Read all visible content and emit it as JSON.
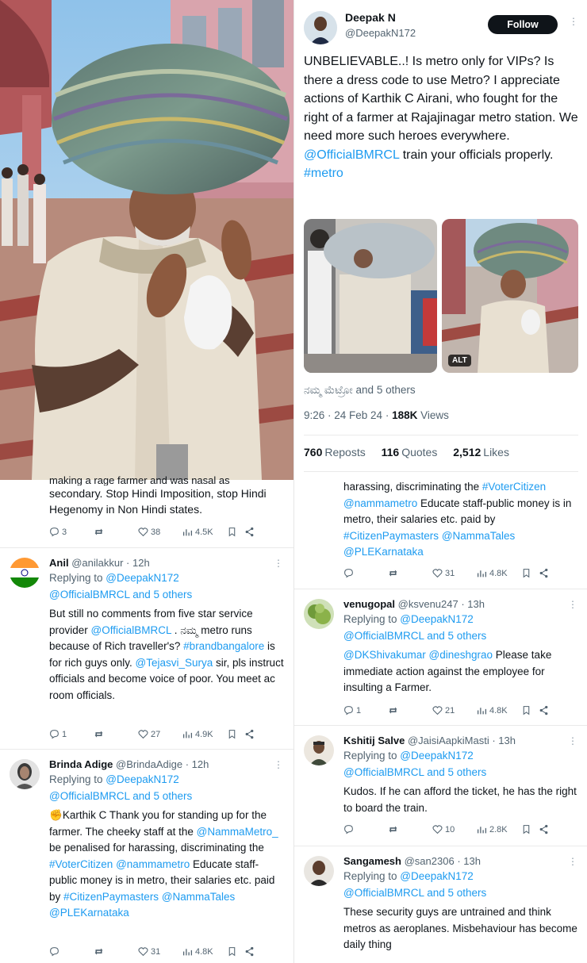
{
  "left_post_fragment": {
    "cut_line": "making a rage farmer and was nasal as",
    "text": "secondary. Stop Hindi Imposition, stop Hindi Hegenomy in Non Hindi states.",
    "replies": "3",
    "likes": "38",
    "views": "4.5K"
  },
  "left_replies": [
    {
      "name": "Anil",
      "handle": "@anilakkur",
      "time": "· 12h",
      "replying_to_prefix": "Replying to ",
      "replying_to": "@DeepakN172",
      "replying_others": "@OfficialBMRCL and 5 others",
      "text_a": "But still no comments from five star service provider ",
      "mention_a": "@OfficialBMRCL",
      "text_b": " . ನಮ್ಮ metro runs because of Rich traveller's? ",
      "hashtag_a": "#brandbangalore",
      "text_c": " is for rich guys only. ",
      "mention_b": "@Tejasvi_Surya",
      "text_d": " sir, pls instruct officials and become voice of poor. You meet ac room officials.",
      "replies": "1",
      "likes": "27",
      "views": "4.9K"
    },
    {
      "name": "Brinda Adige",
      "handle": "@BrindaAdige",
      "time": "· 12h",
      "replying_to_prefix": "Replying to ",
      "replying_to": "@DeepakN172",
      "replying_others": "@OfficialBMRCL and 5 others",
      "emoji": "✊",
      "text_a": "Karthik C Thank you for standing up for the farmer. The cheeky staff at the ",
      "mention_a": "@NammaMetro_",
      "text_b": " be penalised for harassing, discriminating the ",
      "hashtag_a": "#VoterCitizen",
      "mention_b": "@nammametro",
      "text_c": " Educate staff-public money is in metro, their salaries etc. paid by ",
      "hashtag_b": "#CitizenPaymasters",
      "mention_c": "@NammaTales",
      "mention_d": "@PLEKarnataka",
      "replies": "",
      "likes": "31",
      "views": "4.8K"
    }
  ],
  "main_tweet": {
    "name": "Deepak N",
    "handle": "@DeepakN172",
    "follow_label": "Follow",
    "text_a": "UNBELIEVABLE..! Is metro only for VIPs? Is there a dress code to use Metro? I appreciate actions of Karthik C Airani, who fought for the right of a farmer at Rajajinagar metro station. We need more such heroes everywhere. ",
    "mention": "@OfficialBMRCL",
    "text_b": " train your officials properly. ",
    "hashtag": "#metro",
    "alt_label": "ALT",
    "liked_by": "ನಮ್ಮ ಮೆಟ್ರೋ and 5 others",
    "time": "9:26 · 24 Feb 24 · ",
    "views_count": "188K",
    "views_label": " Views",
    "reposts_count": "760",
    "reposts_label": "Reposts",
    "quotes_count": "116",
    "quotes_label": "Quotes",
    "likes_count": "2,512",
    "likes_label": "Likes"
  },
  "right_fragment": {
    "text_a": "harassing, discriminating the ",
    "hashtag_a": "#VoterCitizen",
    "mention_a": "@nammametro",
    "text_b": " Educate staff-public money is in metro, their salaries etc. paid by ",
    "hashtag_b": "#CitizenPaymasters",
    "mention_b": "@NammaTales",
    "mention_c": "@PLEKarnataka",
    "likes": "31",
    "views": "4.8K"
  },
  "right_replies": [
    {
      "name": "venugopal",
      "handle": "@ksvenu247",
      "time": "· 13h",
      "replying_to_prefix": "Replying to ",
      "replying_to": "@DeepakN172",
      "replying_others": "@OfficialBMRCL and 5 others",
      "mention_a": "@DKShivakumar",
      "mention_b": "@dineshgrao",
      "text_a": " Please take immediate action against the employee for insulting a Farmer.",
      "replies": "1",
      "likes": "21",
      "views": "4.8K"
    },
    {
      "name": "Kshitij Salve",
      "handle": "@JaisiAapkiMasti",
      "time": "· 13h",
      "replying_to_prefix": "Replying to ",
      "replying_to": "@DeepakN172",
      "replying_others": "@OfficialBMRCL and 5 others",
      "text_a": "Kudos. If he can afford the ticket, he has the right to board the train.",
      "replies": "",
      "likes": "10",
      "views": "2.8K"
    },
    {
      "name": "Sangamesh",
      "handle": "@san2306",
      "time": "· 13h",
      "replying_to_prefix": "Replying to ",
      "replying_to": "@DeepakN172",
      "replying_others": "@OfficialBMRCL and 5 others",
      "text_a": "These security guys are untrained and think  metros as aeroplanes. Misbehaviour has become daily thing"
    }
  ],
  "colors": {
    "link": "#1d9bf0",
    "muted": "#536471",
    "text": "#0f1419"
  }
}
